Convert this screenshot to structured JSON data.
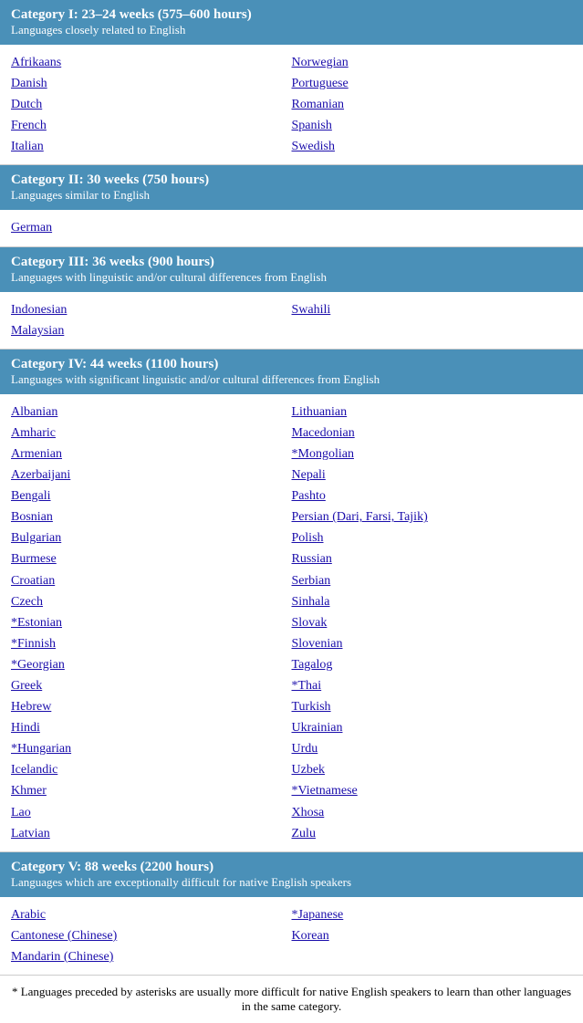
{
  "categories": [
    {
      "id": "cat1",
      "title": "Category I: 23–24 weeks (575–600 hours)",
      "subtitle": "Languages closely related to English",
      "left_langs": [
        {
          "text": "Afrikaans",
          "href": true
        },
        {
          "text": "Danish",
          "href": true
        },
        {
          "text": "Dutch",
          "href": true
        },
        {
          "text": "French",
          "href": true
        },
        {
          "text": "Italian",
          "href": true
        }
      ],
      "right_langs": [
        {
          "text": "Norwegian",
          "href": true
        },
        {
          "text": "Portuguese",
          "href": true
        },
        {
          "text": "Romanian",
          "href": true
        },
        {
          "text": "Spanish",
          "href": true
        },
        {
          "text": "Swedish",
          "href": true
        }
      ]
    },
    {
      "id": "cat2",
      "title": "Category II: 30 weeks (750 hours)",
      "subtitle": "Languages similar to English",
      "left_langs": [
        {
          "text": "German",
          "href": true
        }
      ],
      "right_langs": []
    },
    {
      "id": "cat3",
      "title": "Category III: 36 weeks (900 hours)",
      "subtitle": "Languages with linguistic and/or cultural differences from English",
      "left_langs": [
        {
          "text": "Indonesian",
          "href": true
        },
        {
          "text": "Malaysian",
          "href": true
        }
      ],
      "right_langs": [
        {
          "text": "Swahili",
          "href": true
        }
      ]
    },
    {
      "id": "cat4",
      "title": "Category IV: 44 weeks (1100 hours)",
      "subtitle": "Languages with significant linguistic and/or cultural differences from English",
      "left_langs": [
        {
          "text": "Albanian",
          "href": true
        },
        {
          "text": "Amharic",
          "href": true
        },
        {
          "text": "Armenian",
          "href": true
        },
        {
          "text": "Azerbaijani",
          "href": true
        },
        {
          "text": "Bengali",
          "href": true
        },
        {
          "text": "Bosnian",
          "href": true
        },
        {
          "text": "Bulgarian",
          "href": true
        },
        {
          "text": "Burmese",
          "href": true
        },
        {
          "text": "Croatian",
          "href": true
        },
        {
          "text": "Czech",
          "href": true
        },
        {
          "text": "*Estonian",
          "href": true
        },
        {
          "text": "*Finnish",
          "href": true
        },
        {
          "text": "*Georgian",
          "href": true
        },
        {
          "text": "Greek",
          "href": true
        },
        {
          "text": "Hebrew",
          "href": true
        },
        {
          "text": "Hindi",
          "href": true
        },
        {
          "text": "*Hungarian",
          "href": true
        },
        {
          "text": "Icelandic",
          "href": true
        },
        {
          "text": "Khmer",
          "href": true
        },
        {
          "text": "Lao",
          "href": true
        },
        {
          "text": "Latvian",
          "href": true
        }
      ],
      "right_langs": [
        {
          "text": "Lithuanian",
          "href": true
        },
        {
          "text": "Macedonian",
          "href": true
        },
        {
          "text": "*Mongolian",
          "href": true
        },
        {
          "text": "Nepali",
          "href": true
        },
        {
          "text": "Pashto",
          "href": true
        },
        {
          "text": "Persian (Dari, Farsi, Tajik)",
          "href": true
        },
        {
          "text": "Polish",
          "href": true
        },
        {
          "text": "Russian",
          "href": true
        },
        {
          "text": "Serbian",
          "href": true
        },
        {
          "text": "Sinhala",
          "href": true
        },
        {
          "text": "Slovak",
          "href": true
        },
        {
          "text": "Slovenian",
          "href": true
        },
        {
          "text": "Tagalog",
          "href": true
        },
        {
          "text": "*Thai",
          "href": true
        },
        {
          "text": "Turkish",
          "href": true
        },
        {
          "text": "Ukrainian",
          "href": true
        },
        {
          "text": "Urdu",
          "href": true
        },
        {
          "text": "Uzbek",
          "href": true
        },
        {
          "text": "*Vietnamese",
          "href": true
        },
        {
          "text": "Xhosa",
          "href": true
        },
        {
          "text": "Zulu",
          "href": true
        }
      ]
    },
    {
      "id": "cat5",
      "title": "Category V: 88 weeks (2200 hours)",
      "subtitle": "Languages which are exceptionally difficult for native English speakers",
      "left_langs": [
        {
          "text": "Arabic",
          "href": true
        },
        {
          "text": "Cantonese (Chinese)",
          "href": true
        },
        {
          "text": "Mandarin (Chinese)",
          "href": true
        }
      ],
      "right_langs": [
        {
          "text": "*Japanese",
          "href": true
        },
        {
          "text": "Korean",
          "href": true
        }
      ]
    }
  ],
  "footer_note": "* Languages preceded by asterisks are usually more difficult for native English speakers to learn than other languages in the same category."
}
